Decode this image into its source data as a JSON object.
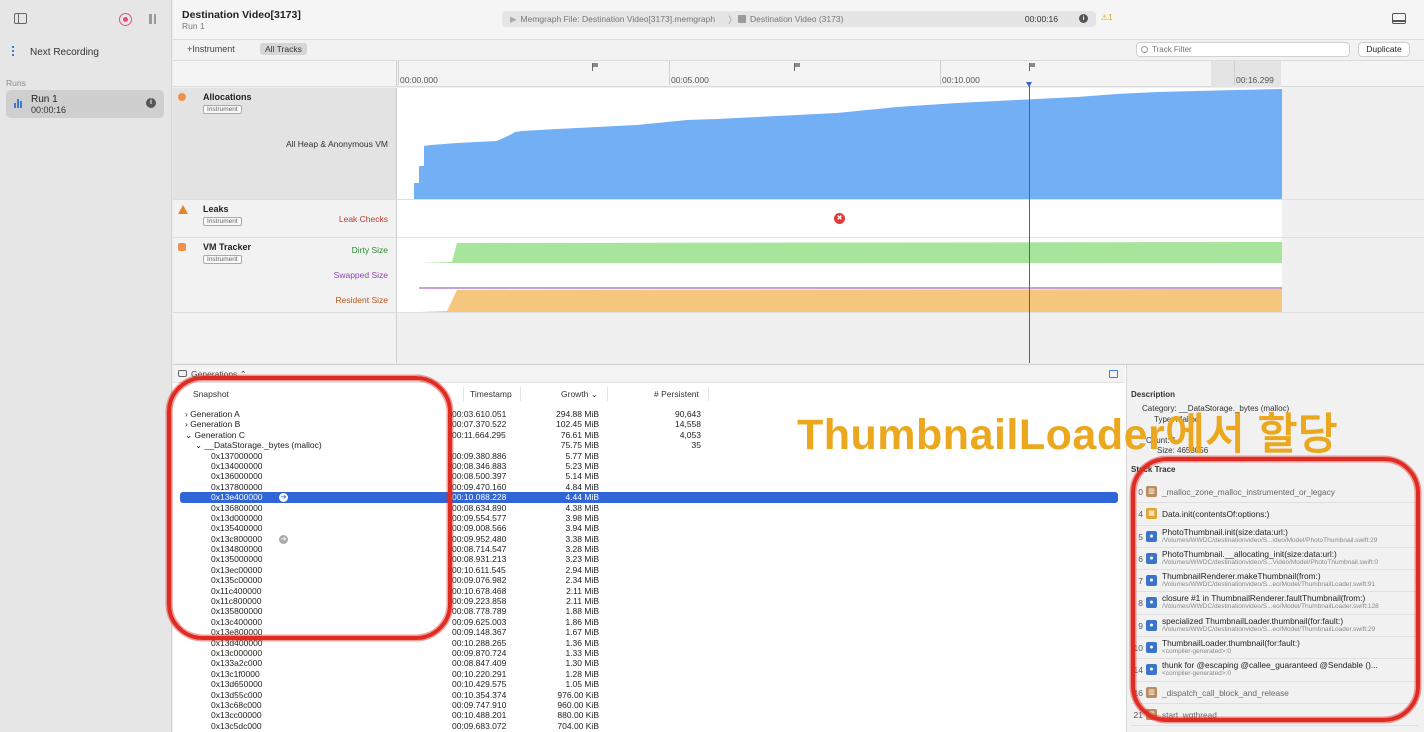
{
  "sidebar": {
    "next_recording": "Next Recording",
    "runs_label": "Runs",
    "run": {
      "title": "Run 1",
      "time": "00:00:16",
      "info": "i"
    }
  },
  "header": {
    "title": "Destination Video[3173]",
    "subtitle": "Run 1",
    "path_file": "Memgraph File: Destination Video[3173].memgraph",
    "path_process": "Destination Video (3173)",
    "time": "00:00:16",
    "info": "i",
    "warning": "⚠1"
  },
  "toolbar": {
    "add_instrument": "+Instrument",
    "all_tracks": "All Tracks",
    "track_filter_placeholder": "Track Filter",
    "duplicate": "Duplicate"
  },
  "ruler": {
    "ticks": [
      "00:00.000",
      "00:05.000",
      "00:10.000",
      "00:16.299"
    ]
  },
  "tracks": {
    "allocations": {
      "name": "Allocations",
      "badge": "Instrument",
      "lane": "All Heap & Anonymous VM"
    },
    "leaks": {
      "name": "Leaks",
      "badge": "Instrument",
      "lane": "Leak Checks",
      "marker": "✖"
    },
    "vm": {
      "name": "VM Tracker",
      "badge": "Instrument",
      "lanes": [
        "Dirty Size",
        "Swapped Size",
        "Resident Size"
      ]
    }
  },
  "colors": {
    "allocations": "#72aff5",
    "dirty": "#a6e59b",
    "resident": "#f4c67e",
    "swapped": "#8e44ad",
    "selection": "#2f65d6",
    "annotation": "#e02b22",
    "overlay_text": "#eba81f"
  },
  "generations": {
    "bar_label": "Generations ⌃",
    "columns": {
      "snapshot": "Snapshot",
      "timestamp": "Timestamp",
      "growth": "Growth ⌄",
      "persistent": "# Persistent"
    },
    "rows": [
      {
        "snapshot": "› Generation A",
        "timestamp": "00:03.610.051",
        "growth": "294.88 MiB",
        "persistent": "90,643"
      },
      {
        "snapshot": "› Generation B",
        "timestamp": "00:07.370.522",
        "growth": "102.45 MiB",
        "persistent": "14,558"
      },
      {
        "snapshot": "⌄ Generation C",
        "timestamp": "00:11.664.295",
        "growth": "76.61 MiB",
        "persistent": "4,053"
      },
      {
        "snapshot": "⌄ __DataStorage._bytes (malloc)",
        "timestamp": "",
        "growth": "75.75 MiB",
        "persistent": "35"
      },
      {
        "snapshot": "0x137000000",
        "timestamp": "00:09.380.886",
        "growth": "5.77 MiB",
        "persistent": ""
      },
      {
        "snapshot": "0x134000000",
        "timestamp": "00:08.346.883",
        "growth": "5.23 MiB",
        "persistent": ""
      },
      {
        "snapshot": "0x136000000",
        "timestamp": "00:08.500.397",
        "growth": "5.14 MiB",
        "persistent": ""
      },
      {
        "snapshot": "0x137800000",
        "timestamp": "00:09.470.160",
        "growth": "4.84 MiB",
        "persistent": ""
      },
      {
        "snapshot": "0x13e400000",
        "timestamp": "00:10.088.228",
        "growth": "4.44 MiB",
        "persistent": ""
      },
      {
        "snapshot": "0x136800000",
        "timestamp": "00:08.634.890",
        "growth": "4.38 MiB",
        "persistent": ""
      },
      {
        "snapshot": "0x13d000000",
        "timestamp": "00:09.554.577",
        "growth": "3.98 MiB",
        "persistent": ""
      },
      {
        "snapshot": "0x135400000",
        "timestamp": "00:09.008.566",
        "growth": "3.94 MiB",
        "persistent": ""
      },
      {
        "snapshot": "0x13c800000",
        "timestamp": "00:09.952.480",
        "growth": "3.38 MiB",
        "persistent": ""
      },
      {
        "snapshot": "0x134800000",
        "timestamp": "00:08.714.547",
        "growth": "3.28 MiB",
        "persistent": ""
      },
      {
        "snapshot": "0x135000000",
        "timestamp": "00:08.931.213",
        "growth": "3.23 MiB",
        "persistent": ""
      },
      {
        "snapshot": "0x13ec00000",
        "timestamp": "00:10.611.545",
        "growth": "2.94 MiB",
        "persistent": ""
      },
      {
        "snapshot": "0x135c00000",
        "timestamp": "00:09.076.982",
        "growth": "2.34 MiB",
        "persistent": ""
      },
      {
        "snapshot": "0x11c400000",
        "timestamp": "00:10.678.468",
        "growth": "2.11 MiB",
        "persistent": ""
      },
      {
        "snapshot": "0x11c800000",
        "timestamp": "00:09.223.858",
        "growth": "2.11 MiB",
        "persistent": ""
      },
      {
        "snapshot": "0x135800000",
        "timestamp": "00:08.778.789",
        "growth": "1.88 MiB",
        "persistent": ""
      },
      {
        "snapshot": "0x13c400000",
        "timestamp": "00:09.625.003",
        "growth": "1.86 MiB",
        "persistent": ""
      },
      {
        "snapshot": "0x13e800000",
        "timestamp": "00:09.148.367",
        "growth": "1.67 MiB",
        "persistent": ""
      },
      {
        "snapshot": "0x13d400000",
        "timestamp": "00:10.288.265",
        "growth": "1.36 MiB",
        "persistent": ""
      },
      {
        "snapshot": "0x13c000000",
        "timestamp": "00:09.870.724",
        "growth": "1.33 MiB",
        "persistent": ""
      },
      {
        "snapshot": "0x133a2c000",
        "timestamp": "00:08.847.409",
        "growth": "1.30 MiB",
        "persistent": ""
      },
      {
        "snapshot": "0x13c1f0000",
        "timestamp": "00:10.220.291",
        "growth": "1.28 MiB",
        "persistent": ""
      },
      {
        "snapshot": "0x13d650000",
        "timestamp": "00:10.429.575",
        "growth": "1.05 MiB",
        "persistent": ""
      },
      {
        "snapshot": "0x13d55c000",
        "timestamp": "00:10.354.374",
        "growth": "976.00 KiB",
        "persistent": ""
      },
      {
        "snapshot": "0x13c68c000",
        "timestamp": "00:09.747.910",
        "growth": "960.00 KiB",
        "persistent": ""
      },
      {
        "snapshot": "0x13cc00000",
        "timestamp": "00:10.488.201",
        "growth": "880.00 KiB",
        "persistent": ""
      },
      {
        "snapshot": "0x13c5dc000",
        "timestamp": "00:09.683.072",
        "growth": "704.00 KiB",
        "persistent": ""
      }
    ]
  },
  "inspector": {
    "description_label": "Description",
    "category": "Category: __DataStorage._bytes (malloc)",
    "type": "Type: Malloc",
    "count": "Count: 1",
    "size": "Size: 4653056",
    "stack_label": "Stack Trace",
    "frames": [
      {
        "num": "0",
        "icon": "lib",
        "name": "_malloc_zone_malloc_instrumented_or_legacy",
        "path": ""
      },
      {
        "num": "4",
        "icon": "dat",
        "name": "Data.init(contentsOf:options:)",
        "path": ""
      },
      {
        "num": "5",
        "icon": "usr",
        "name": "PhotoThumbnail.init(size:data:url:)",
        "path": "/Volumes/WWDC/destinationvideo/S...ideo/Model/PhotoThumbnail.swift:29"
      },
      {
        "num": "6",
        "icon": "usr",
        "name": "PhotoThumbnail.__allocating_init(size:data:url:)",
        "path": "/Volumes/WWDC/destinationvideo/S...Video/Model/PhotoThumbnail.swift:0"
      },
      {
        "num": "7",
        "icon": "usr",
        "name": "ThumbnailRenderer.makeThumbnail(from:)",
        "path": "/Volumes/WWDC/destinationvideo/S...eo/Model/ThumbnailLoader.swift:91"
      },
      {
        "num": "8",
        "icon": "usr",
        "name": "closure #1 in ThumbnailRenderer.faultThumbnail(from:)",
        "path": "/Volumes/WWDC/destinationvideo/S...eo/Model/ThumbnailLoader.swift:128"
      },
      {
        "num": "9",
        "icon": "usr",
        "name": "specialized ThumbnailLoader.thumbnail(for:fault:)",
        "path": "/Volumes/WWDC/destinationvideo/S...eo/Model/ThumbnailLoader.swift:29"
      },
      {
        "num": "10",
        "icon": "usr",
        "name": "ThumbnailLoader.thumbnail(for:fault:)",
        "path": "<compiler-generated>:0"
      },
      {
        "num": "14",
        "icon": "usr",
        "name": "thunk for @escaping @callee_guaranteed @Sendable ()...",
        "path": "<compiler-generated>:0"
      },
      {
        "num": "16",
        "icon": "lib",
        "name": "_dispatch_call_block_and_release",
        "path": ""
      },
      {
        "num": "21",
        "icon": "lib",
        "name": "start_wqthread",
        "path": ""
      }
    ]
  },
  "overlay": {
    "caption": "ThumbnailLoader에서 할당"
  }
}
